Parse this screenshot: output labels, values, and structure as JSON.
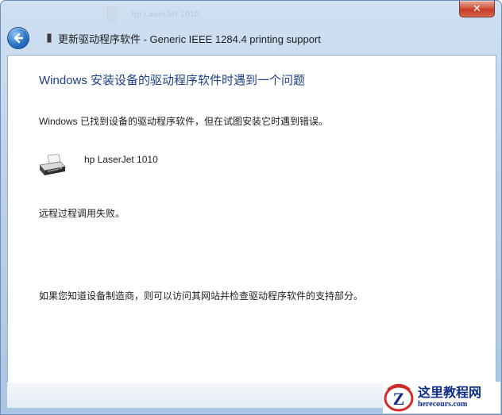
{
  "window": {
    "title": "更新驱动程序软件 - Generic IEEE 1284.4 printing support",
    "background_ghost_text": "hp LaserJet 1010",
    "close_glyph": "✕"
  },
  "content": {
    "heading": "Windows 安装设备的驱动程序软件时遇到一个问题",
    "found_message": "Windows 已找到设备的驱动程序软件，但在试图安装它时遇到错误。",
    "device": {
      "icon": "printer-icon",
      "name": "hp LaserJet 1010"
    },
    "error_message": "远程过程调用失败。",
    "help_message": "如果您知道设备制造商，则可以访问其网站并检查驱动程序软件的支持部分。"
  },
  "watermark": {
    "logo_letter": "Z",
    "name": "这里教程网",
    "url": "herecours.com"
  },
  "colors": {
    "heading": "#1e3f8a",
    "chrome": "#bcd2ea",
    "close_button": "#c43c22",
    "watermark_text": "#0e2f86"
  }
}
